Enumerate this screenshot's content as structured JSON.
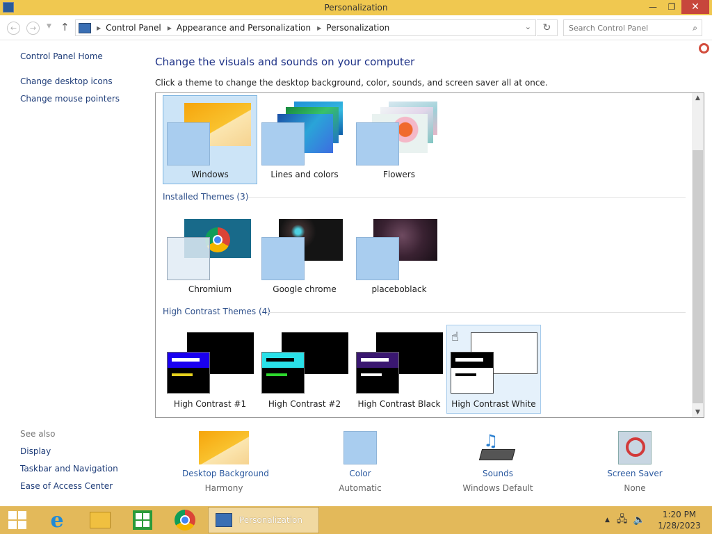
{
  "window": {
    "title": "Personalization",
    "minimize_glyph": "—",
    "maximize_glyph": "❐",
    "close_glyph": "✕"
  },
  "address_bar": {
    "breadcrumbs": [
      "Control Panel",
      "Appearance and Personalization",
      "Personalization"
    ],
    "search_placeholder": "Search Control Panel"
  },
  "left_pane": {
    "home": "Control Panel Home",
    "links": [
      "Change desktop icons",
      "Change mouse pointers"
    ],
    "see_also_title": "See also",
    "see_also": [
      "Display",
      "Taskbar and Navigation",
      "Ease of Access Center"
    ]
  },
  "main": {
    "heading": "Change the visuals and sounds on your computer",
    "subheading": "Click a theme to change the desktop background, color, sounds, and screen saver all at once."
  },
  "themes": {
    "default": [
      "Windows",
      "Lines and colors",
      "Flowers"
    ],
    "installed_label": "Installed Themes (3)",
    "installed": [
      "Chromium",
      "Google chrome",
      "placeboblack"
    ],
    "high_contrast_label": "High Contrast Themes (4)",
    "high_contrast": [
      "High Contrast #1",
      "High Contrast #2",
      "High Contrast Black",
      "High Contrast White"
    ],
    "selected": "Windows",
    "hovered": "High Contrast White"
  },
  "quick_links": [
    {
      "label": "Desktop Background",
      "value": "Harmony"
    },
    {
      "label": "Color",
      "value": "Automatic"
    },
    {
      "label": "Sounds",
      "value": "Windows Default"
    },
    {
      "label": "Screen Saver",
      "value": "None"
    }
  ],
  "taskbar": {
    "active_window": "Personalization",
    "time": "1:20 PM",
    "date": "1/28/2023"
  },
  "colors": {
    "title_bar": "#f0c850",
    "taskbar": "#e3b95a",
    "link": "#1e3c78",
    "heading": "#1e3287",
    "selection": "#cce4f7"
  }
}
